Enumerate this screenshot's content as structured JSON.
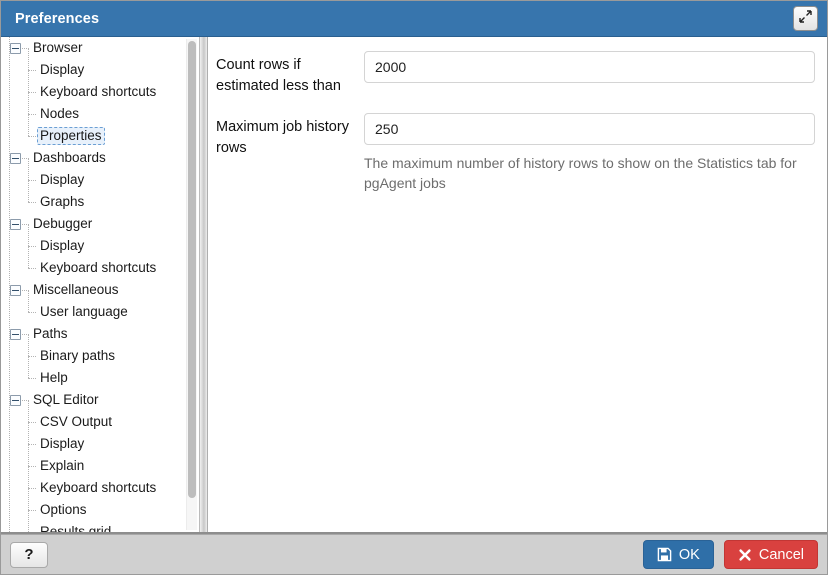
{
  "window": {
    "title": "Preferences",
    "maximize_icon": "expand-diagonal-icon"
  },
  "tree": {
    "scrollbar": "vertical-scrollbar",
    "selected": "Properties",
    "nodes": [
      {
        "label": "Browser",
        "level": 0,
        "expanded": true,
        "toggle": "collapse-box-minus"
      },
      {
        "label": "Display",
        "level": 1
      },
      {
        "label": "Keyboard shortcuts",
        "level": 1
      },
      {
        "label": "Nodes",
        "level": 1
      },
      {
        "label": "Properties",
        "level": 1,
        "selected": true
      },
      {
        "label": "Dashboards",
        "level": 0,
        "expanded": true,
        "toggle": "collapse-box-minus"
      },
      {
        "label": "Display",
        "level": 1
      },
      {
        "label": "Graphs",
        "level": 1,
        "last": true
      },
      {
        "label": "Debugger",
        "level": 0,
        "expanded": true,
        "toggle": "collapse-box-minus"
      },
      {
        "label": "Display",
        "level": 1
      },
      {
        "label": "Keyboard shortcuts",
        "level": 1,
        "last": true
      },
      {
        "label": "Miscellaneous",
        "level": 0,
        "expanded": true,
        "toggle": "collapse-box-minus"
      },
      {
        "label": "User language",
        "level": 1,
        "last": true
      },
      {
        "label": "Paths",
        "level": 0,
        "expanded": true,
        "toggle": "collapse-box-minus"
      },
      {
        "label": "Binary paths",
        "level": 1
      },
      {
        "label": "Help",
        "level": 1,
        "last": true
      },
      {
        "label": "SQL Editor",
        "level": 0,
        "expanded": true,
        "toggle": "collapse-box-minus"
      },
      {
        "label": "CSV Output",
        "level": 1
      },
      {
        "label": "Display",
        "level": 1
      },
      {
        "label": "Explain",
        "level": 1
      },
      {
        "label": "Keyboard shortcuts",
        "level": 1
      },
      {
        "label": "Options",
        "level": 1
      },
      {
        "label": "Results grid",
        "level": 1,
        "clipped": true
      }
    ]
  },
  "form": {
    "fields": [
      {
        "label": "Count rows if estimated less than",
        "value": "2000",
        "placeholder": "",
        "help": ""
      },
      {
        "label": "Maximum job history rows",
        "value": "250",
        "placeholder": "",
        "help": "The maximum number of history rows to show on the Statistics tab for pgAgent jobs"
      }
    ]
  },
  "footer": {
    "help_label": "?",
    "ok_label": "OK",
    "cancel_label": "Cancel",
    "ok_icon": "save-floppy-icon",
    "cancel_icon": "close-x-icon"
  },
  "colors": {
    "titlebar": "#3775ad",
    "ok_button": "#2f6fa8",
    "cancel_button": "#d9413f",
    "footer": "#d0d0d0",
    "selection": "#e8f1fb"
  }
}
